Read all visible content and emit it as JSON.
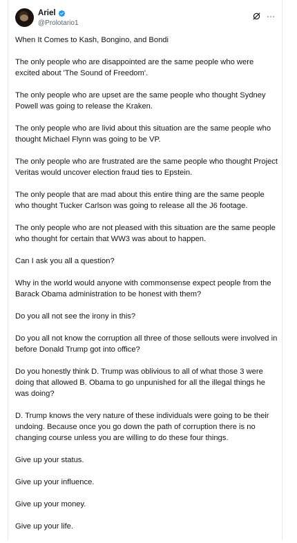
{
  "author": {
    "display_name": "Ariel",
    "handle": "@Prolotario1",
    "verified_color": "#1d9bf0"
  },
  "icons": {
    "verified": "verified-badge-icon",
    "grok": "grok-icon",
    "more": "more-icon"
  },
  "post": {
    "paragraphs": [
      "When It Comes to Kash, Bongino, and Bondi",
      "The only people who are disappointed are the same people who were excited about 'The Sound of Freedom'.",
      "The only people who are upset are the same people who thought Sydney Powell was going to release the Kraken.",
      "The only people who are livid about this situation are the same people who thought Michael Flynn was going to be VP.",
      "The only people who are frustrated are the same people who thought Project Veritas would uncover election fraud ties to Epstein.",
      "The only people that are mad about this entire thing are the same people who thought Tucker Carlson was going to release all the J6 footage.",
      "The only people who are not pleased with this situation are the same people who thought for certain that  WW3 was about to happen.",
      "Can I ask you all a question?",
      "Why in the world would anyone with commonsense expect people from the Barack Obama administration to be honest with them?",
      "Do you all not see the irony in this?",
      "Do you all not know the corruption all three of those sellouts were involved in before Donald Trump got into office?",
      "Do you honestly think D. Trump was oblivious to all of  what those 3 were doing that allowed B. Obama to go unpunished for all the illegal things he was doing?",
      "D. Trump knows the very nature of these individuals were going to be their undoing. Because once you go down the path of corruption there is no changing course unless you are willing to do these four things.",
      "Give up your status.",
      "Give up your influence.",
      "Give up your money.",
      "Give up your life."
    ]
  }
}
